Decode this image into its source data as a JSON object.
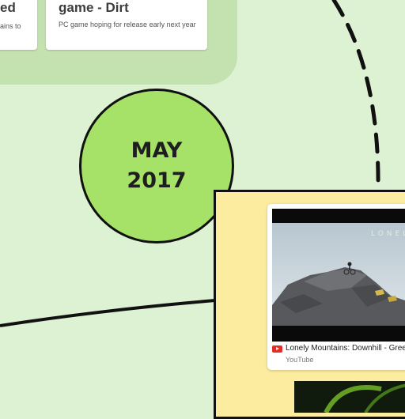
{
  "colors": {
    "background": "#dcf2d2",
    "group_bg": "#c4e2b0",
    "date_circle": "#a6e268",
    "event_panel": "#fcec9f"
  },
  "cards": [
    {
      "title": "ame I\ned",
      "description": "ains to"
    },
    {
      "title": "downhill mtb video\ngame - Dirt",
      "description": "PC game hoping for release early next year"
    }
  ],
  "date": {
    "month": "MAY",
    "year": "2017"
  },
  "video": {
    "thumbnail_text": "LONEL",
    "title": "Lonely Mountains: Downhill - Gree",
    "source": "YouTube",
    "source_icon": "youtube-icon"
  }
}
